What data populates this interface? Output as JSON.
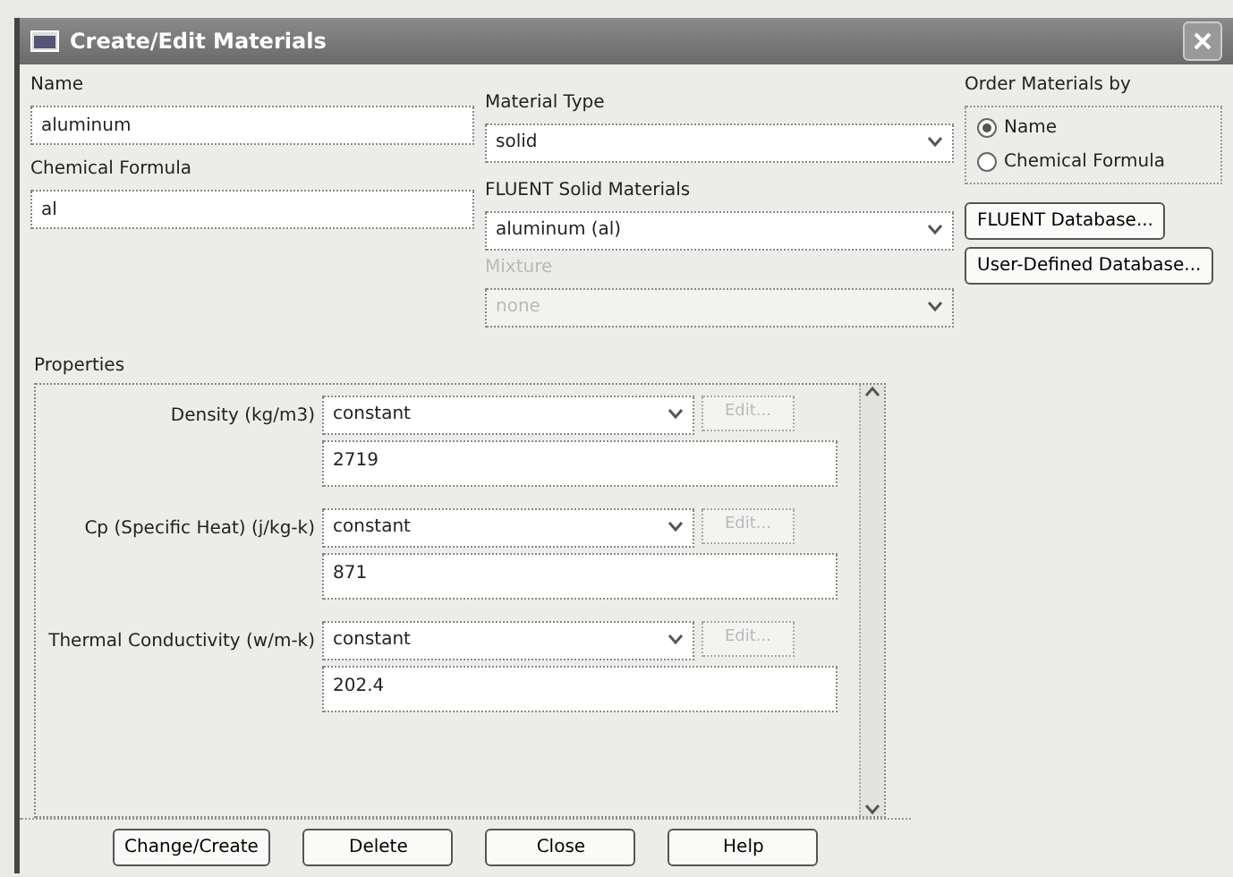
{
  "window": {
    "title": "Create/Edit Materials"
  },
  "name": {
    "label": "Name",
    "value": "aluminum"
  },
  "chemical_formula": {
    "label": "Chemical Formula",
    "value": "al"
  },
  "material_type": {
    "label": "Material Type",
    "value": "solid",
    "disabled": false
  },
  "fluent_materials": {
    "label": "FLUENT Solid Materials",
    "value": "aluminum (al)",
    "disabled": false
  },
  "mixture": {
    "label": "Mixture",
    "value": "none",
    "disabled": true
  },
  "order_by": {
    "label": "Order Materials by",
    "options": [
      {
        "label": "Name",
        "selected": true
      },
      {
        "label": "Chemical Formula",
        "selected": false
      }
    ]
  },
  "database_buttons": [
    "FLUENT Database...",
    "User-Defined Database..."
  ],
  "properties": {
    "label": "Properties",
    "items": [
      {
        "label": "Density (kg/m3)",
        "method": "constant",
        "edit": "Edit...",
        "edit_disabled": true,
        "value": "2719"
      },
      {
        "label": "Cp (Specific Heat) (j/kg-k)",
        "method": "constant",
        "edit": "Edit...",
        "edit_disabled": true,
        "value": "871"
      },
      {
        "label": "Thermal Conductivity (w/m-k)",
        "method": "constant",
        "edit": "Edit...",
        "edit_disabled": true,
        "value": "202.4"
      }
    ]
  },
  "buttons": [
    "Change/Create",
    "Delete",
    "Close",
    "Help"
  ]
}
